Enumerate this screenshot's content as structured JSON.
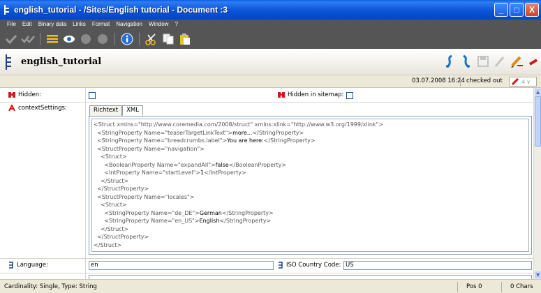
{
  "window": {
    "title": "english_tutorial - /Sites/English tutorial - Document :3",
    "minimize": "_",
    "maximize": "□",
    "close": "X"
  },
  "menu": {
    "items": [
      "File",
      "Edit",
      "Binary data",
      "Links",
      "Format",
      "Navigation",
      "Window",
      "?"
    ]
  },
  "document": {
    "title": "english_tutorial",
    "date": "03.07.2008 16:24",
    "state": "checked out",
    "version": "4"
  },
  "fields": {
    "hidden_label": "Hidden:",
    "hidden_sitemap_label": "Hidden in sitemap:",
    "context_label": "contextSettings:",
    "language_label": "Language:",
    "language_value": "en",
    "iso_label": "ISO Country Code:",
    "iso_value": "US"
  },
  "tabs": [
    "Richtext",
    "XML"
  ],
  "xml": [
    {
      "indent": "",
      "pre": "<Struct xmlns=\"http://www.coremedia.com/2008/struct\" xmlns:xlink=\"http://www.w3.org/1999/xlink\">",
      "val": "",
      "post": ""
    },
    {
      "indent": "  ",
      "pre": "<StringProperty Name=\"teaserTargetLinkText\">",
      "val": "more...",
      "post": "</StringProperty>"
    },
    {
      "indent": "  ",
      "pre": "<StringProperty Name=\"breadcrumbs.label\">",
      "val": "You are here:",
      "post": "</StringProperty>"
    },
    {
      "indent": "  ",
      "pre": "<StructProperty Name=\"navigation\">",
      "val": "",
      "post": ""
    },
    {
      "indent": "    ",
      "pre": "<Struct>",
      "val": "",
      "post": ""
    },
    {
      "indent": "      ",
      "pre": "<BooleanProperty Name=\"expandAll\">",
      "val": "false",
      "post": "</BooleanProperty>"
    },
    {
      "indent": "      ",
      "pre": "<IntProperty Name=\"startLevel\">",
      "val": "1",
      "post": "</IntProperty>"
    },
    {
      "indent": "    ",
      "pre": "</Struct>",
      "val": "",
      "post": ""
    },
    {
      "indent": "  ",
      "pre": "</StructProperty>",
      "val": "",
      "post": ""
    },
    {
      "indent": "  ",
      "pre": "<StructProperty Name=\"locales\">",
      "val": "",
      "post": ""
    },
    {
      "indent": "    ",
      "pre": "<Struct>",
      "val": "",
      "post": ""
    },
    {
      "indent": "      ",
      "pre": "<StringProperty Name=\"de_DE\">",
      "val": "German",
      "post": "</StringProperty>"
    },
    {
      "indent": "      ",
      "pre": "<StringProperty Name=\"en_US\">",
      "val": "English",
      "post": "</StringProperty>"
    },
    {
      "indent": "    ",
      "pre": "</Struct>",
      "val": "",
      "post": ""
    },
    {
      "indent": "  ",
      "pre": "</StructProperty>",
      "val": "",
      "post": ""
    },
    {
      "indent": "",
      "pre": "</Struct>",
      "val": "",
      "post": ""
    }
  ],
  "statusbar": {
    "text": "Cardinality: Single, Type: String",
    "pos": "Pos 0",
    "chars": "0 Chars"
  },
  "colors": {
    "titlebar": "#0a53d6",
    "toolbar_bg": "#555555",
    "label_icon_red": "#d01a1a"
  }
}
